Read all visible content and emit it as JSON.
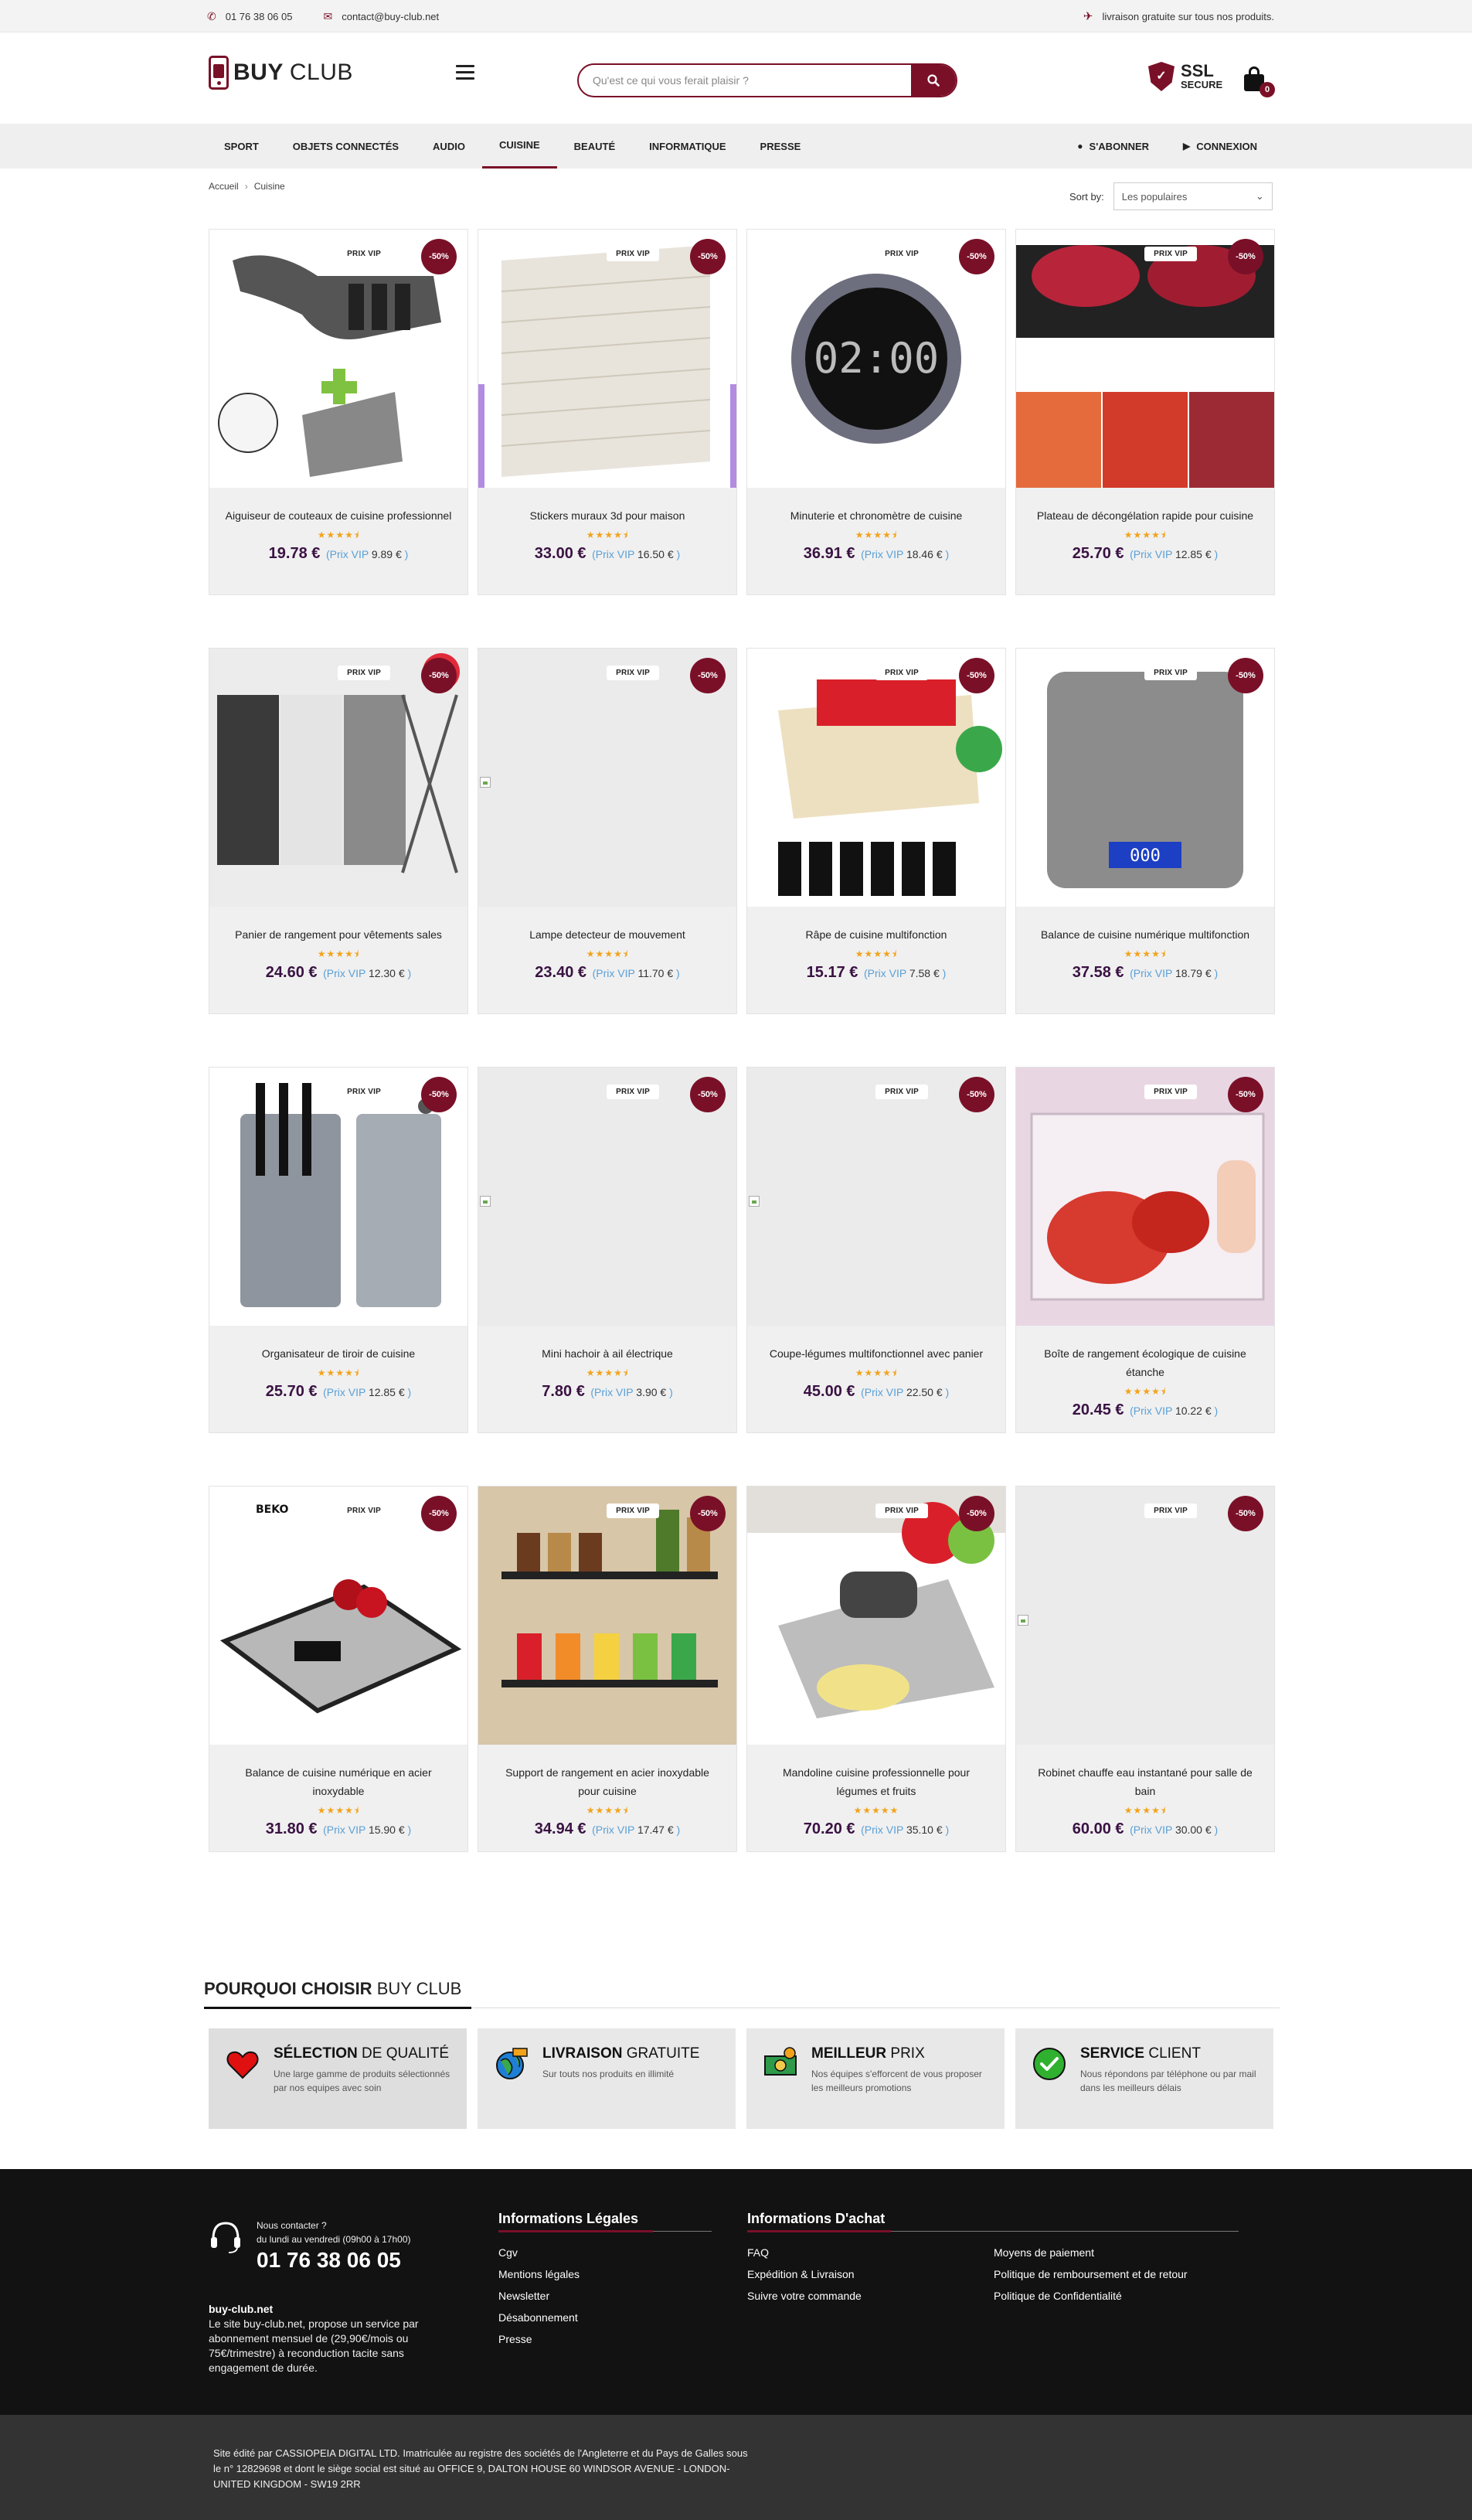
{
  "topbar": {
    "phone": "01 76 38 06 05",
    "email": "contact@buy-club.net",
    "shipping": "livraison gratuite sur tous nos produits."
  },
  "header": {
    "logo_bold": "BUY",
    "logo_light": "CLUB",
    "search_placeholder": "Qu'est ce qui vous ferait plaisir ?",
    "ssl_big": "SSL",
    "ssl_small": "SECURE",
    "cart_count": "0"
  },
  "nav": {
    "items": [
      "SPORT",
      "OBJETS CONNECTÉS",
      "AUDIO",
      "CUISINE",
      "BEAUTÉ",
      "INFORMATIQUE",
      "PRESSE"
    ],
    "active": "CUISINE",
    "subscribe": "S'ABONNER",
    "login": "CONNEXION"
  },
  "breadcrumb": {
    "home": "Accueil",
    "current": "Cuisine"
  },
  "sort": {
    "label": "Sort by:",
    "selected": "Les populaires"
  },
  "labels": {
    "vip_badge": "PRIX VIP",
    "discount": "-50%",
    "vip_price_prefix": "(Prix VIP",
    "vip_price_suffix": ")"
  },
  "products": [
    {
      "name": "Aiguiseur de couteaux de cuisine professionnel",
      "price": "19.78 €",
      "vip": "9.89 €",
      "rating": 4.5,
      "image": "knife-sharpener"
    },
    {
      "name": "Stickers muraux 3d pour maison",
      "price": "33.00 €",
      "vip": "16.50 €",
      "rating": 4.5,
      "image": "wall-stickers"
    },
    {
      "name": "Minuterie et chronomètre de cuisine",
      "price": "36.91 €",
      "vip": "18.46 €",
      "rating": 4.5,
      "image": "timer"
    },
    {
      "name": "Plateau de décongélation rapide pour cuisine",
      "price": "25.70 €",
      "vip": "12.85 €",
      "rating": 4.5,
      "image": "defrost-tray"
    },
    {
      "name": "Panier de rangement pour vêtements sales",
      "price": "24.60 €",
      "vip": "12.30 €",
      "rating": 4.5,
      "image": "laundry-basket"
    },
    {
      "name": "Lampe detecteur de mouvement",
      "price": "23.40 €",
      "vip": "11.70 €",
      "rating": 4.5,
      "image": "broken"
    },
    {
      "name": "Râpe de cuisine multifonction",
      "price": "15.17 €",
      "vip": "7.58 €",
      "rating": 4.5,
      "image": "grater"
    },
    {
      "name": "Balance de cuisine numérique multifonction",
      "price": "37.58 €",
      "vip": "18.79 €",
      "rating": 4.5,
      "image": "scale-silver"
    },
    {
      "name": "Organisateur de tiroir de cuisine",
      "price": "25.70 €",
      "vip": "12.85 €",
      "rating": 4.5,
      "image": "drawer-organizer"
    },
    {
      "name": "Mini hachoir à ail électrique",
      "price": "7.80 €",
      "vip": "3.90 €",
      "rating": 4.5,
      "image": "broken"
    },
    {
      "name": "Coupe-légumes multifonctionnel avec panier",
      "price": "45.00 €",
      "vip": "22.50 €",
      "rating": 4.5,
      "image": "broken"
    },
    {
      "name": "Boîte de rangement écologique de cuisine étanche",
      "price": "20.45 €",
      "vip": "10.22 €",
      "rating": 4.5,
      "image": "storage-box"
    },
    {
      "name": "Balance de cuisine numérique en acier inoxydable",
      "price": "31.80 €",
      "vip": "15.90 €",
      "rating": 4.5,
      "image": "scale-steel"
    },
    {
      "name": "Support de rangement en acier inoxydable pour cuisine",
      "price": "34.94 €",
      "vip": "17.47 €",
      "rating": 4.5,
      "image": "spice-rack"
    },
    {
      "name": "Mandoline cuisine professionnelle pour légumes et fruits",
      "price": "70.20 €",
      "vip": "35.10 €",
      "rating": 5,
      "image": "mandoline"
    },
    {
      "name": "Robinet chauffe eau instantané pour salle de bain",
      "price": "60.00 €",
      "vip": "30.00 €",
      "rating": 4.5,
      "image": "broken"
    }
  ],
  "why": {
    "title_bold": "POURQUOI CHOISIR",
    "title_light": "BUY CLUB",
    "features": [
      {
        "bold": "SÉLECTION",
        "light": "DE QUALITÉ",
        "text": "Une large gamme de produits sélectionnés par nos equipes avec soin",
        "icon": "heart-icon"
      },
      {
        "bold": "LIVRAISON",
        "light": "GRATUITE",
        "text": "Sur touts nos produits en illimité",
        "icon": "globe-delivery-icon"
      },
      {
        "bold": "MEILLEUR",
        "light": "PRIX",
        "text": "Nos équipes s'efforcent de vous proposer les meilleurs promotions",
        "icon": "money-icon"
      },
      {
        "bold": "SERVICE",
        "light": "CLIENT",
        "text": "Nous répondons par téléphone ou par mail dans les meilleurs délais",
        "icon": "check-circle-icon"
      }
    ]
  },
  "footer": {
    "contact_small": "Nous contacter ?",
    "hours": "du lundi au vendredi (09h00 à 17h00)",
    "phone": "01 76 38 06 05",
    "about_title": "buy-club.net",
    "about_text": "Le site buy-club.net, propose un service par abonnement mensuel de (29,90€/mois ou 75€/trimestre) à reconduction tacite sans engagement de durée.",
    "legal_title": "Informations Légales",
    "legal_links": [
      "Cgv",
      "Mentions légales",
      "Newsletter",
      "Désabonnement",
      "Presse"
    ],
    "purchase_title": "Informations D'achat",
    "purchase_links_left": [
      "FAQ",
      "Expédition & Livraison",
      "Suivre votre commande"
    ],
    "purchase_links_right": [
      "Moyens de paiement",
      "Politique de remboursement et de retour",
      "Politique de Confidentialité"
    ],
    "bottom_text": "Site édité par CASSIOPEIA DIGITAL LTD. Imatriculée au registre des sociétés de l'Angleterre et du Pays de Galles sous le n° 12829698 et dont le siège social est situé au OFFICE 9, DALTON HOUSE 60 WINDSOR AVENUE - LONDON- UNITED KINGDOM - SW19 2RR"
  },
  "colors": {
    "brand": "#7a1028",
    "price": "#3a1243",
    "stars": "#f2a31b",
    "vip_link": "#5aa0d6"
  }
}
